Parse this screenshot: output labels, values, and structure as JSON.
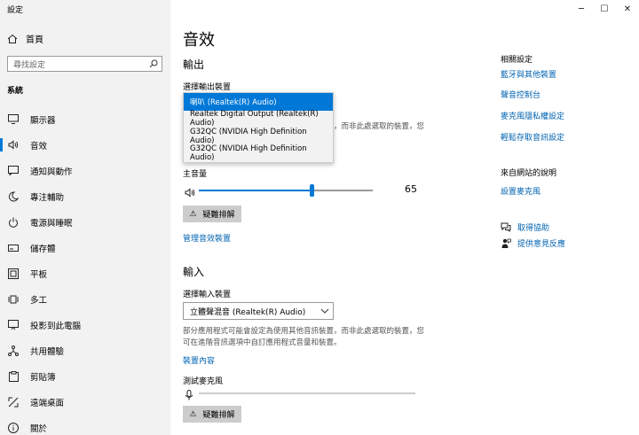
{
  "window": {
    "title": "設定",
    "minimize": "─",
    "maximize": "☐",
    "close": "✕"
  },
  "sidebar": {
    "home_label": "首頁",
    "search_placeholder": "尋找設定",
    "section_label": "系統",
    "items": [
      {
        "label": "顯示器",
        "icon": "monitor-icon"
      },
      {
        "label": "音效",
        "icon": "speaker-icon",
        "selected": true
      },
      {
        "label": "通知與動作",
        "icon": "notification-icon"
      },
      {
        "label": "專注輔助",
        "icon": "moon-icon"
      },
      {
        "label": "電源與睡眠",
        "icon": "power-icon"
      },
      {
        "label": "儲存體",
        "icon": "storage-icon"
      },
      {
        "label": "平板",
        "icon": "tablet-icon"
      },
      {
        "label": "多工",
        "icon": "multitask-icon"
      },
      {
        "label": "投影到此電腦",
        "icon": "project-icon"
      },
      {
        "label": "共用體驗",
        "icon": "share-icon"
      },
      {
        "label": "剪貼簿",
        "icon": "clipboard-icon"
      },
      {
        "label": "遠端桌面",
        "icon": "remote-icon"
      },
      {
        "label": "關於",
        "icon": "info-icon"
      }
    ]
  },
  "main": {
    "page_title": "音效",
    "output": {
      "heading": "輸出",
      "device_label": "選擇輸出裝置",
      "options": [
        "喇叭 (Realtek(R) Audio)",
        "Realtek Digital Output (Realtek(R) Audio)",
        "G32QC (NVIDIA High Definition Audio)",
        "G32QC (NVIDIA High Definition Audio)"
      ],
      "selected_index": 0,
      "partial_desc": "，而非此處選取的裝置，您",
      "master_volume_label": "主音量",
      "volume_value": "65",
      "volume": 65,
      "troubleshoot_label": "疑難排解",
      "manage_link": "管理音效裝置"
    },
    "input": {
      "heading": "輸入",
      "device_label": "選擇輸入裝置",
      "selected_device": "立體聲混音 (Realtek(R) Audio)",
      "desc_line1": "部分應用程式可能會設定為使用其他音訊裝置，而非此處選取的裝置，您",
      "desc_line2": "可在進階音訊選項中自訂應用程式音量和裝置。",
      "device_props_link": "裝置內容",
      "test_mic_label": "測試麥克風",
      "troubleshoot_label": "疑難排解"
    }
  },
  "related": {
    "heading": "相關設定",
    "links": [
      "藍牙與其他裝置",
      "聲音控制台",
      "麥克風隱私權設定",
      "輕鬆存取音訊設定"
    ],
    "web_help_heading": "來自網站的說明",
    "web_help_link": "設置麥克風",
    "get_help": "取得協助",
    "feedback": "提供意見反應"
  },
  "colors": {
    "accent": "#0078d7",
    "link": "#0063b1",
    "sidebar_bg": "#f2f2f2"
  }
}
